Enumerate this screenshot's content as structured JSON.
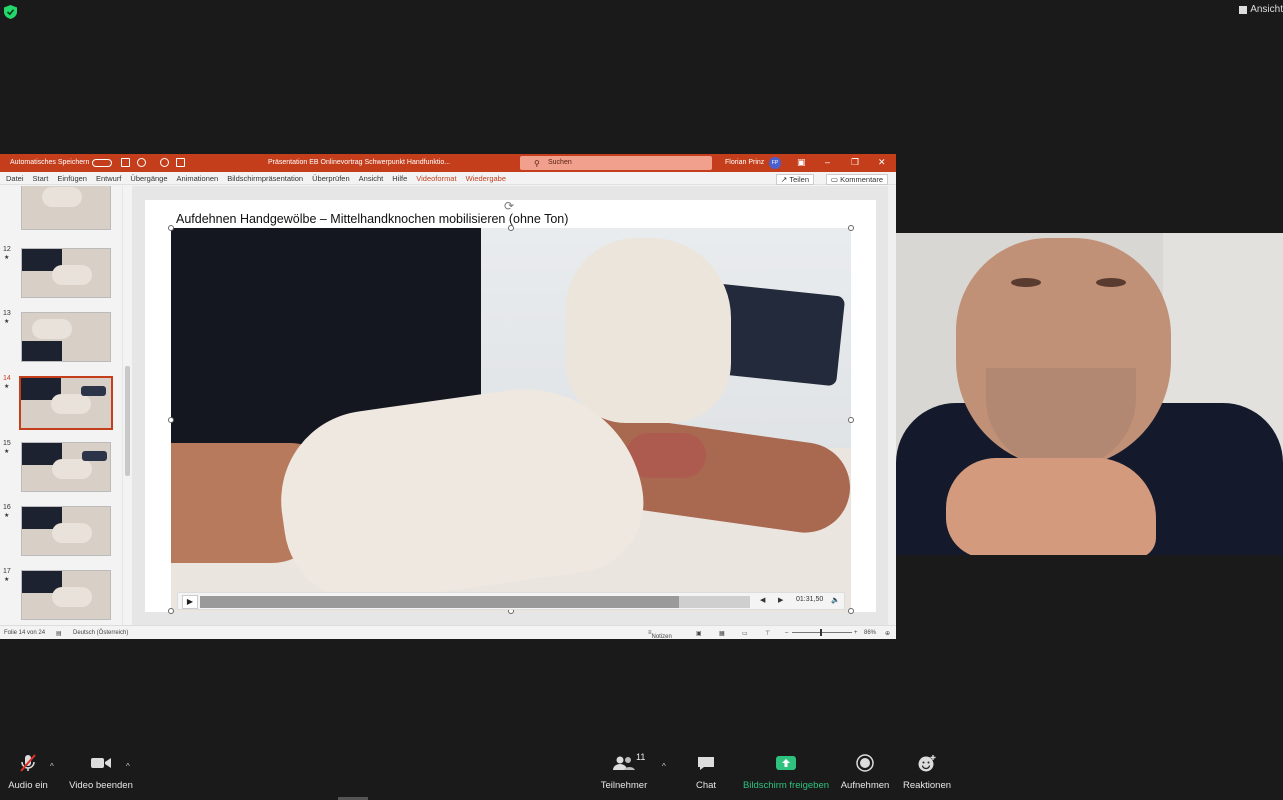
{
  "topbar": {
    "view_label": "Ansicht"
  },
  "ppt": {
    "autosave_label": "Automatisches Speichern",
    "document_title": "Präsentation EB Onlinevortrag Schwerpunkt Handfunktio...",
    "search_placeholder": "Suchen",
    "user_name": "Florian Prinz",
    "user_initials": "FP",
    "menu": [
      "Datei",
      "Start",
      "Einfügen",
      "Entwurf",
      "Übergänge",
      "Animationen",
      "Bildschirmpräsentation",
      "Überprüfen",
      "Ansicht",
      "Hilfe",
      "Videoformat",
      "Wiedergabe"
    ],
    "share_label": "Teilen",
    "comments_label": "Kommentare",
    "thumbnails": [
      {
        "num": "12"
      },
      {
        "num": "13"
      },
      {
        "num": "14"
      },
      {
        "num": "15"
      },
      {
        "num": "16"
      },
      {
        "num": "17"
      }
    ],
    "slide_title": "Aufdehnen Handgewölbe – Mittelhandknochen mobilisieren (ohne Ton)",
    "video": {
      "time": "01:31,50",
      "progress": 0.87
    },
    "status": {
      "slide_info": "Folie 14 von 24",
      "language": "Deutsch (Österreich)",
      "notes": "Notizen",
      "zoom": "86%"
    }
  },
  "toolbar": {
    "audio_label": "Audio ein",
    "video_label": "Video beenden",
    "participants_label": "Teilnehmer",
    "participants_count": "11",
    "chat_label": "Chat",
    "share_label": "Bildschirm freigeben",
    "record_label": "Aufnehmen",
    "reactions_label": "Reaktionen"
  },
  "colors": {
    "ppt_accent": "#c43e1c",
    "share_green": "#2ec27e",
    "background": "#1a1a1a"
  }
}
